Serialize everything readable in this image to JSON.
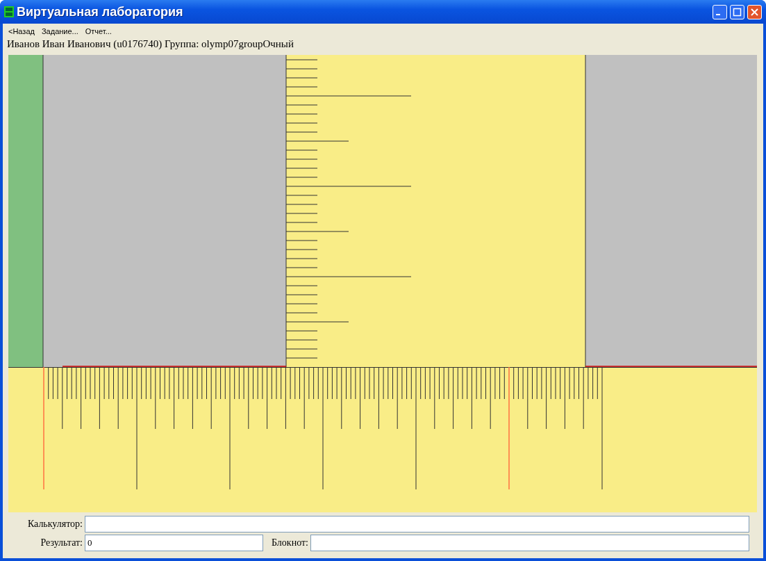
{
  "window": {
    "title": "Виртуальная лаборатория"
  },
  "menu": [
    "<Назад",
    "Задание...",
    "Отчет..."
  ],
  "user_line": "Иванов Иван Иванович (u0176740)  Группа: olymp07groupОчный",
  "fields": [
    {
      "label": "Калькулятор:"
    },
    {
      "label": "Результат:",
      "value": "0"
    },
    {
      "label": "Блокнот:"
    }
  ]
}
